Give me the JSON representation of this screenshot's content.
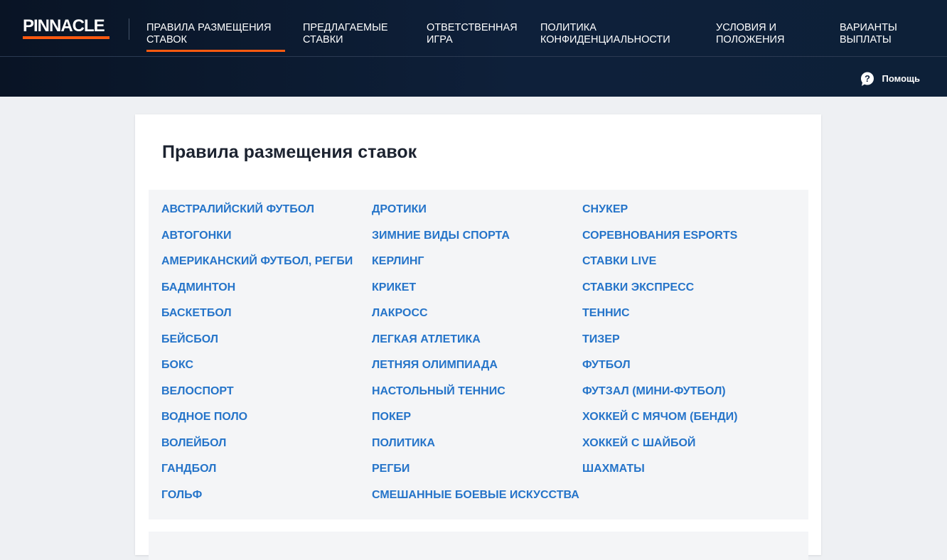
{
  "brand": {
    "logo_text": "PINNACLE",
    "accent_color": "#ff5a10",
    "header_color": "#0e203a",
    "link_color": "#2574c9"
  },
  "nav": {
    "items": [
      {
        "label": "ПРАВИЛА РАЗМЕЩЕНИЯ\nСТАВОК",
        "active": true
      },
      {
        "label": "ПРЕДЛАГАЕМЫЕ\nСТАВКИ",
        "active": false
      },
      {
        "label": "ОТВЕТСТВЕННАЯ\nИГРА",
        "active": false
      },
      {
        "label": "ПОЛИТИКА\nКОНФИДЕНЦИАЛЬНОСТИ",
        "active": false
      },
      {
        "label": "УСЛОВИЯ И\nПОЛОЖЕНИЯ",
        "active": false
      },
      {
        "label": "ВАРИАНТЫ\nВЫПЛАТЫ",
        "active": false
      }
    ]
  },
  "help": {
    "label": "Помощь",
    "icon": "help-question-icon"
  },
  "main": {
    "title": "Правила размещения ставок",
    "columns": [
      [
        "АВСТРАЛИЙСКИЙ ФУТБОЛ",
        "АВТОГОНКИ",
        "АМЕРИКАНСКИЙ ФУТБОЛ, РЕГБИ",
        "БАДМИНТОН",
        "БАСКЕТБОЛ",
        "БЕЙСБОЛ",
        "БОКС",
        "ВЕЛОСПОРТ",
        "ВОДНОЕ ПОЛО",
        "ВОЛЕЙБОЛ",
        "ГАНДБОЛ",
        "ГОЛЬФ"
      ],
      [
        "ДРОТИКИ",
        "ЗИМНИЕ ВИДЫ СПОРТА",
        "КЕРЛИНГ",
        "КРИКЕТ",
        "ЛАКРОСС",
        "ЛЕГКАЯ АТЛЕТИКА",
        "ЛЕТНЯЯ ОЛИМПИАДА",
        "НАСТОЛЬНЫЙ ТЕННИС",
        "ПОКЕР",
        "ПОЛИТИКА",
        "РЕГБИ",
        "СМЕШАННЫЕ БОЕВЫЕ ИСКУССТВА"
      ],
      [
        "СНУКЕР",
        "СОРЕВНОВАНИЯ ESPORTS",
        "СТАВКИ LIVE",
        "СТАВКИ ЭКСПРЕСС",
        "ТЕННИС",
        "ТИЗЕР",
        "ФУТБОЛ",
        "ФУТЗАЛ (МИНИ-ФУТБОЛ)",
        "ХОККЕЙ С МЯЧОМ (БЕНДИ)",
        "ХОККЕЙ С ШАЙБОЙ",
        "ШАХМАТЫ"
      ]
    ]
  }
}
